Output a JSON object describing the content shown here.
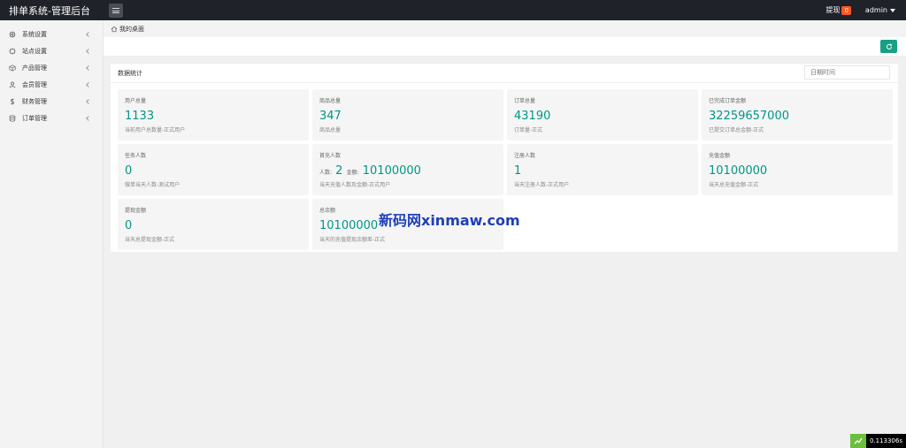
{
  "header": {
    "brand": "排单系统-管理后台",
    "withdraw_label": "提现",
    "withdraw_count": "0",
    "user": "admin"
  },
  "sidebar": {
    "items": [
      {
        "label": "系统设置",
        "icon": "gear-icon"
      },
      {
        "label": "站点设置",
        "icon": "cog-icon"
      },
      {
        "label": "产品管理",
        "icon": "box-icon"
      },
      {
        "label": "会员管理",
        "icon": "user-icon"
      },
      {
        "label": "财务管理",
        "icon": "dollar-icon"
      },
      {
        "label": "订单管理",
        "icon": "database-icon"
      }
    ]
  },
  "breadcrumb": "我的桌面",
  "panel": {
    "title": "数据统计",
    "date_placeholder": "日期时间"
  },
  "cards": [
    {
      "title": "用户总量",
      "value": "1133",
      "desc": "当前用户总数量-正式用户"
    },
    {
      "title": "商品总量",
      "value": "347",
      "desc": "商品总量"
    },
    {
      "title": "订单总量",
      "value": "43190",
      "desc": "订单量-正式"
    },
    {
      "title": "已完成订单金额",
      "value": "32259657000",
      "desc": "已提交订单总金额-正式"
    },
    {
      "title": "任务人数",
      "value": "0",
      "desc": "做单当天人数-测试用户"
    },
    {
      "title": "首充人数",
      "people_label": "人数:",
      "people_value": "2",
      "amount_label": "金额:",
      "amount_value": "10100000",
      "desc": "当天充值人数及金额-正式用户"
    },
    {
      "title": "注册人数",
      "value": "1",
      "desc": "当天注册人数-正式用户"
    },
    {
      "title": "充值金额",
      "value": "10100000",
      "desc": "当天总充值金额-正式"
    },
    {
      "title": "提现金额",
      "value": "0",
      "desc": "当天总提现金额-正式"
    },
    {
      "title": "总余额",
      "value": "10100000",
      "desc": "当天的充值提现余额差-正式"
    }
  ],
  "watermark": "新码网xinmaw.com",
  "timer": "0.113306s",
  "colors": {
    "accent": "#009688",
    "topbar": "#20222a",
    "badge": "#ff5722",
    "watermark": "#1f3fb8"
  }
}
